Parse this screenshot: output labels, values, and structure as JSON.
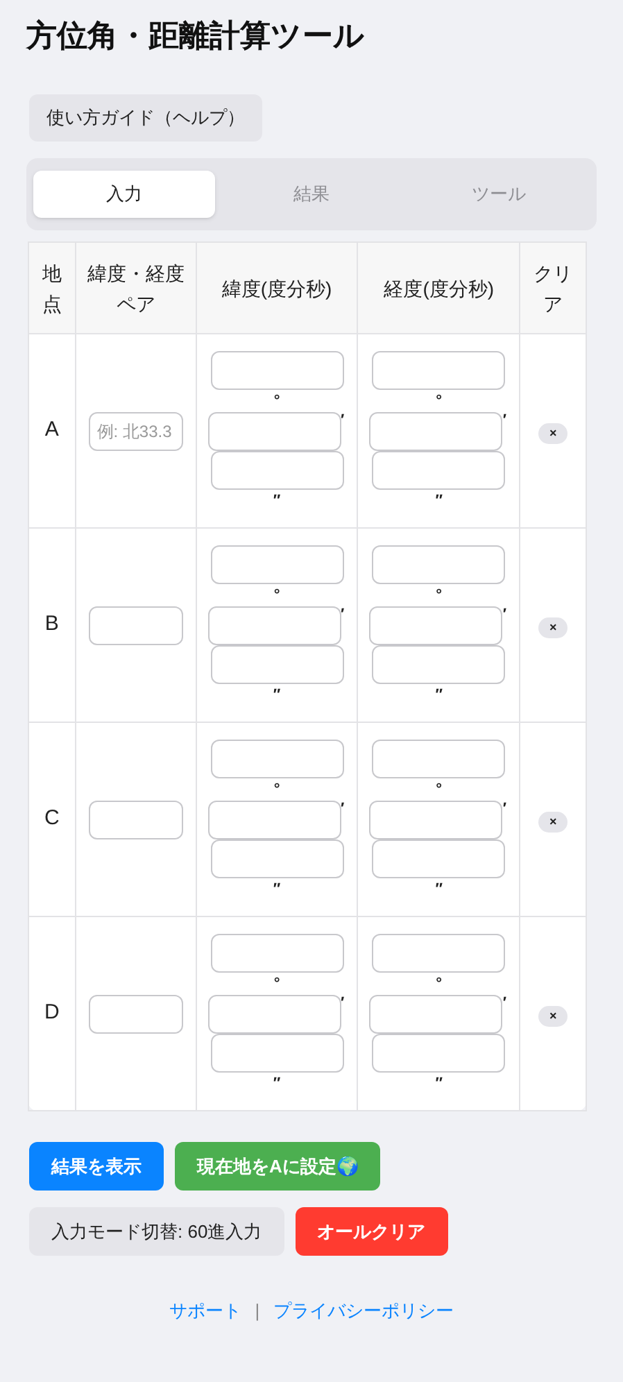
{
  "title": "方位角・距離計算ツール",
  "help_button": "使い方ガイド（ヘルプ）",
  "tabs": [
    {
      "label": "入力",
      "selected": true
    },
    {
      "label": "結果",
      "selected": false
    },
    {
      "label": "ツール",
      "selected": false
    }
  ],
  "table": {
    "columns": [
      "地点",
      "緯度・経度ペア",
      "緯度(度分秒)",
      "経度(度分秒)",
      "クリア"
    ],
    "rows": [
      {
        "point": "A",
        "pair_placeholder": "例: 北33.3",
        "latitude_units": [
          "°",
          "′",
          "″"
        ],
        "longitude_units": [
          "°",
          "′",
          "″"
        ],
        "clear": "×"
      },
      {
        "point": "B",
        "latitude_units": [
          "°",
          "′",
          "″"
        ],
        "longitude_units": [
          "°",
          "′",
          "″"
        ],
        "clear": "×"
      },
      {
        "point": "C",
        "latitude_units": [
          "°",
          "′",
          "″"
        ],
        "longitude_units": [
          "°",
          "′",
          "″"
        ],
        "clear": "×"
      },
      {
        "point": "D",
        "latitude_units": [
          "°",
          "′",
          "″"
        ],
        "longitude_units": [
          "°",
          "′",
          "″"
        ],
        "clear": "×"
      }
    ]
  },
  "actions": [
    {
      "label": "結果を表示",
      "kind": "primary"
    },
    {
      "label": "現在地をAに設定🌍",
      "kind": "success"
    },
    {
      "label": "入力モード切替: 60進入力",
      "kind": "neutral"
    },
    {
      "label": "オールクリア",
      "kind": "danger"
    }
  ],
  "footer": {
    "links": [
      "サポート",
      "プライバシーポリシー"
    ],
    "separator": "|"
  }
}
